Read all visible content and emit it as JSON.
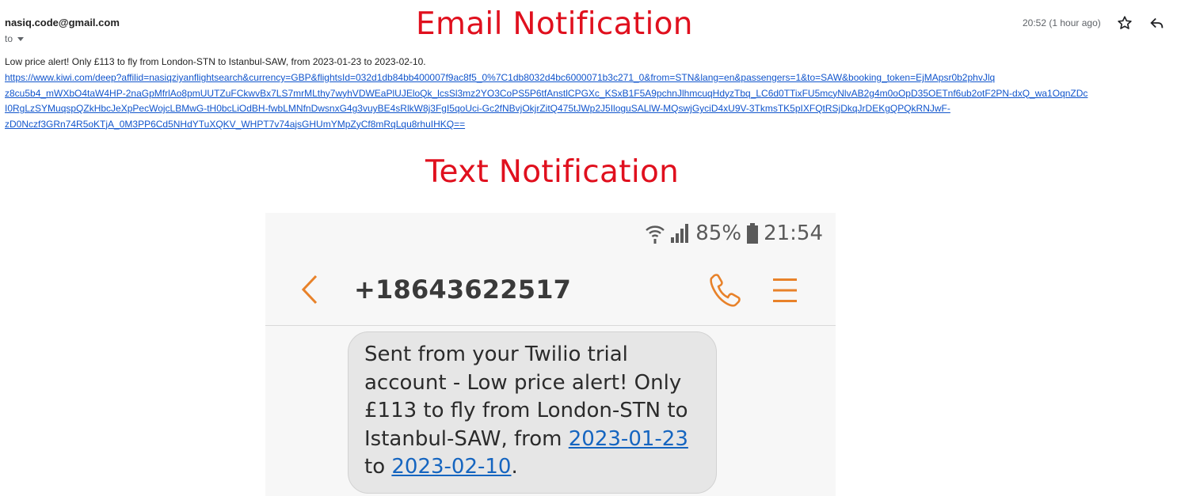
{
  "email": {
    "sender": "nasiq.code@gmail.com",
    "to_label": "to",
    "timestamp": "20:52 (1 hour ago)",
    "heading": "Email Notification",
    "body_text": "Low price alert! Only £113 to fly from London-STN to Istanbul-SAW, from 2023-01-23 to 2023-02-10.",
    "link_lines": [
      "https://www.kiwi.com/deep?affilid=nasiqziyanflightsearch&currency=GBP&flightsId=032d1db84bb400007f9ac8f5_0%7C1db8032d4bc6000071b3c271_0&from=STN&lang=en&passengers=1&to=SAW&booking_token=EjMApsr0b2phvJlq",
      "z8cu5b4_mWXbO4taW4HP-2naGpMfrlAo8pmUUTZuFCkwvBx7LS7mrMLthy7wyhVDWEaPlUJEloQk_lcsSl3mz2YO3CoPS5P6tfAnstlCPGXc_KSxB1F5A9pchnJlhmcuqHdyzTbq_LC6d0TTixFU5mcyNlvAB2g4m0oOpD35OETnf6ub2otF2PN-dxQ_wa1OqnZDc",
      "I0RgLzSYMuqspQZkHbcJeXpPecWojcLBMwG-tH0bcLiOdBH-fwbLMNfnDwsnxG4g3vuyBE4sRlkW8j3FgI5qoUci-Gc2fNBvjOkjrZitQ475tJWp2J5IloguSALlW-MQswjGyciD4xU9V-3TkmsTK5pIXFQtRSjDkqJrDEKgQPQkRNJwF-",
      "zD0Nczf3GRn74R5oKTjA_0M3PP6Cd5NHdYTuXQKV_WHPT7v74ajsGHUmYMpZyCf8mRqLqu8rhuIHKQ=="
    ]
  },
  "sms": {
    "heading": "Text Notification",
    "status": {
      "battery": "85%",
      "time": "21:54"
    },
    "contact": "+18643622517",
    "message_part1": "Sent from your Twilio trial account - Low price alert! Only £113 to fly from London-STN to Istanbul-SAW, from ",
    "date_from": "2023-01-23",
    "message_mid": " to ",
    "date_to": "2023-02-10",
    "message_end": "."
  },
  "colors": {
    "heading_red": "#e0101e",
    "accent_orange": "#e8822a",
    "link_blue": "#1155cc"
  },
  "icons": [
    "star-icon",
    "reply-icon",
    "wifi-icon",
    "signal-icon",
    "battery-icon",
    "back-arrow-icon",
    "phone-icon",
    "menu-icon"
  ]
}
